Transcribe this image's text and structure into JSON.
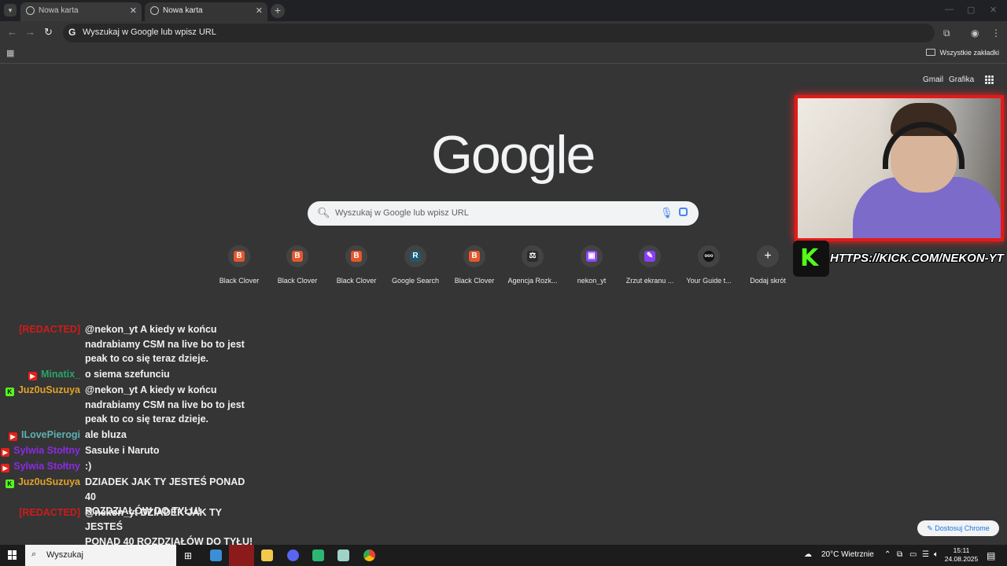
{
  "browser": {
    "tabs": [
      {
        "title": "Nowa karta",
        "active": false
      },
      {
        "title": "Nowa karta",
        "active": true
      }
    ],
    "omnibox_text": "Wyszukaj w Google lub wpisz URL",
    "all_bookmarks_label": "Wszystkie zakładki"
  },
  "newtab": {
    "top_links": [
      "Gmail",
      "Grafika"
    ],
    "logo_text": "Google",
    "search_placeholder": "Wyszukaj w Google lub wpisz URL",
    "shortcuts": [
      {
        "label": "Black Clover",
        "icon": "B",
        "color": "#e4572e"
      },
      {
        "label": "Black Clover",
        "icon": "B",
        "color": "#e4572e"
      },
      {
        "label": "Black Clover",
        "icon": "B",
        "color": "#e4572e"
      },
      {
        "label": "Google Search",
        "icon": "R",
        "color": "#1e5a6b"
      },
      {
        "label": "Black Clover",
        "icon": "B",
        "color": "#e4572e"
      },
      {
        "label": "Agencja Rozk...",
        "icon": "⚖",
        "color": "#2b2b2b"
      },
      {
        "label": "nekon_yt",
        "icon": "▣",
        "color": "#9146ff"
      },
      {
        "label": "Zrzut ekranu ...",
        "icon": "✎",
        "color": "#8a3ffc"
      },
      {
        "label": "Your Guide t...",
        "icon": "ooo",
        "color": "#111111"
      },
      {
        "label": "Dodaj skrót",
        "icon": "+",
        "color": "#434343"
      }
    ],
    "customize_label": "Dostosuj Chrome"
  },
  "overlay": {
    "kick_logo": "K",
    "kick_url": "HTTPS://KICK.COM/NEKON-YT"
  },
  "chat": [
    {
      "user": "[REDACTED]",
      "user_color": "#d11a1a",
      "platform": "",
      "lines": [
        "@nekon_yt A kiedy w końcu",
        "nadrabiamy CSM na live bo to jest",
        "peak to co się teraz dzieje."
      ]
    },
    {
      "user": "Minatix_",
      "user_color": "#2aa56a",
      "platform": "youtube",
      "lines": [
        "o siema szefunciu"
      ]
    },
    {
      "user": "Juz0uSuzuya",
      "user_color": "#e0a32a",
      "platform": "kick",
      "lines": [
        "@nekon_yt A kiedy w końcu",
        "nadrabiamy CSM na live bo to jest",
        "peak to co się teraz dzieje."
      ]
    },
    {
      "user": "ILovePierogi",
      "user_color": "#5fb0b0",
      "platform": "youtube",
      "lines": [
        "ale bluza"
      ]
    },
    {
      "user": "Sylwia Stołtny",
      "user_color": "#8a2be2",
      "platform": "youtube",
      "lines": [
        "Sasuke i Naruto"
      ]
    },
    {
      "user": "Sylwia Stołtny",
      "user_color": "#8a2be2",
      "platform": "youtube",
      "lines": [
        ":)"
      ]
    },
    {
      "user": "Juz0uSuzuya",
      "user_color": "#e0a32a",
      "platform": "kick",
      "lines": [
        "DZIADEK JAK TY JESTEŚ PONAD 40",
        "ROZDZIAŁÓW DO TYŁU!"
      ]
    },
    {
      "user": "[REDACTED]",
      "user_color": "#d11a1a",
      "platform": "",
      "lines": [
        "@nekon_yt DZIADEK JAK TY JESTEŚ",
        "PONAD 40 ROZDZIAŁÓW DO TYŁU!"
      ]
    }
  ],
  "taskbar": {
    "search_placeholder": "Wyszukaj",
    "weather": "20°C  Wietrznie",
    "time": "15:11",
    "date": "24.08.2025"
  }
}
